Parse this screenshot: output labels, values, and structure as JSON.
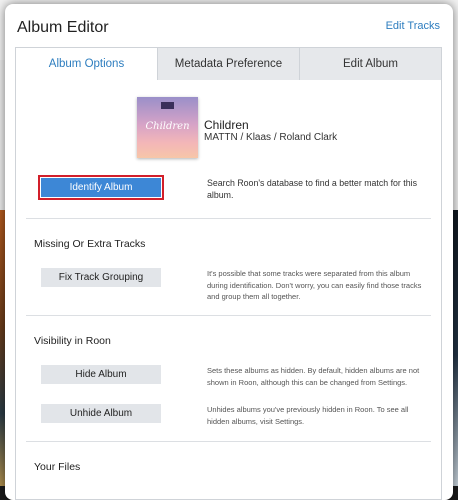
{
  "dialog": {
    "title": "Album Editor",
    "edit_tracks": "Edit Tracks"
  },
  "tabs": [
    {
      "label": "Album Options",
      "active": true
    },
    {
      "label": "Metadata Preference",
      "active": false
    },
    {
      "label": "Edit Album",
      "active": false
    }
  ],
  "album": {
    "cover_text": "Children",
    "title": "Children",
    "artist": "MATTN / Klaas / Roland Clark"
  },
  "identify": {
    "button_label": "Identify Album",
    "description": "Search Roon's database to find a better match for this album."
  },
  "missing_tracks": {
    "heading": "Missing Or Extra Tracks",
    "button_label": "Fix Track Grouping",
    "description": "It's possible that some tracks were separated from this album during identification. Don't worry, you can easily find those tracks and group them all together."
  },
  "visibility": {
    "heading": "Visibility in Roon",
    "hide_label": "Hide Album",
    "hide_description": "Sets these albums as hidden. By default, hidden albums are not shown in Roon, although this can be changed from Settings.",
    "unhide_label": "Unhide Album",
    "unhide_description": "Unhides albums you've previously hidden in Roon. To see all hidden albums, visit Settings."
  },
  "files": {
    "heading": "Your Files"
  },
  "colors": {
    "accent": "#2d7dbf",
    "primary_button": "#3d87d6",
    "highlight_outline": "#d21f2a"
  }
}
